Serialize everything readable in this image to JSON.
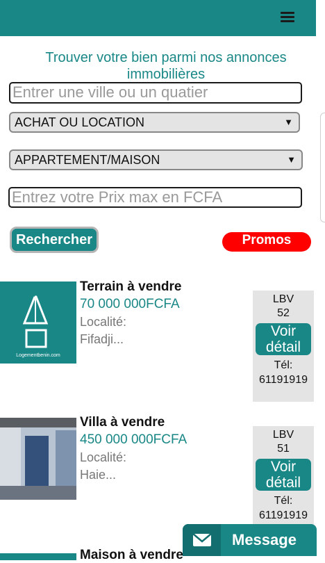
{
  "header": {
    "menu_icon": "hamburger-menu-icon",
    "color": "#1a8787"
  },
  "search": {
    "headline": "Trouver votre bien parmi nos annonces immobilières",
    "city_placeholder": "Entrer une ville ou un quatier",
    "transaction_select": "ACHAT OU LOCATION",
    "type_select": "APPARTEMENT/MAISON",
    "price_placeholder": "Entrez votre Prix max en FCFA",
    "search_button": "Rechercher",
    "promos_button": "Promos"
  },
  "listings": [
    {
      "title": "Terrain à vendre",
      "price": "70 000 000FCFA",
      "locality_label": "Localité:",
      "locality": "Fifadji...",
      "ref": "LBV",
      "ref_num": "52",
      "detail_button": "Voir détail",
      "tel_label": "Tél:",
      "tel": "61191919",
      "logo_text": "Logementbenin.com"
    },
    {
      "title": "Villa à vendre",
      "price": "450 000 000FCFA",
      "locality_label": "Localité:",
      "locality": "Haie...",
      "ref": "LBV",
      "ref_num": "51",
      "detail_button": "Voir détail",
      "tel_label": "Tél:",
      "tel": "61191919"
    }
  ],
  "next_listing_title": "Maison à vendre",
  "message_button": {
    "label": "Message",
    "icon": "envelope-icon"
  },
  "colors": {
    "accent": "#1a8787",
    "promo": "#ff0000",
    "side_panel": "#e4e4e4"
  }
}
